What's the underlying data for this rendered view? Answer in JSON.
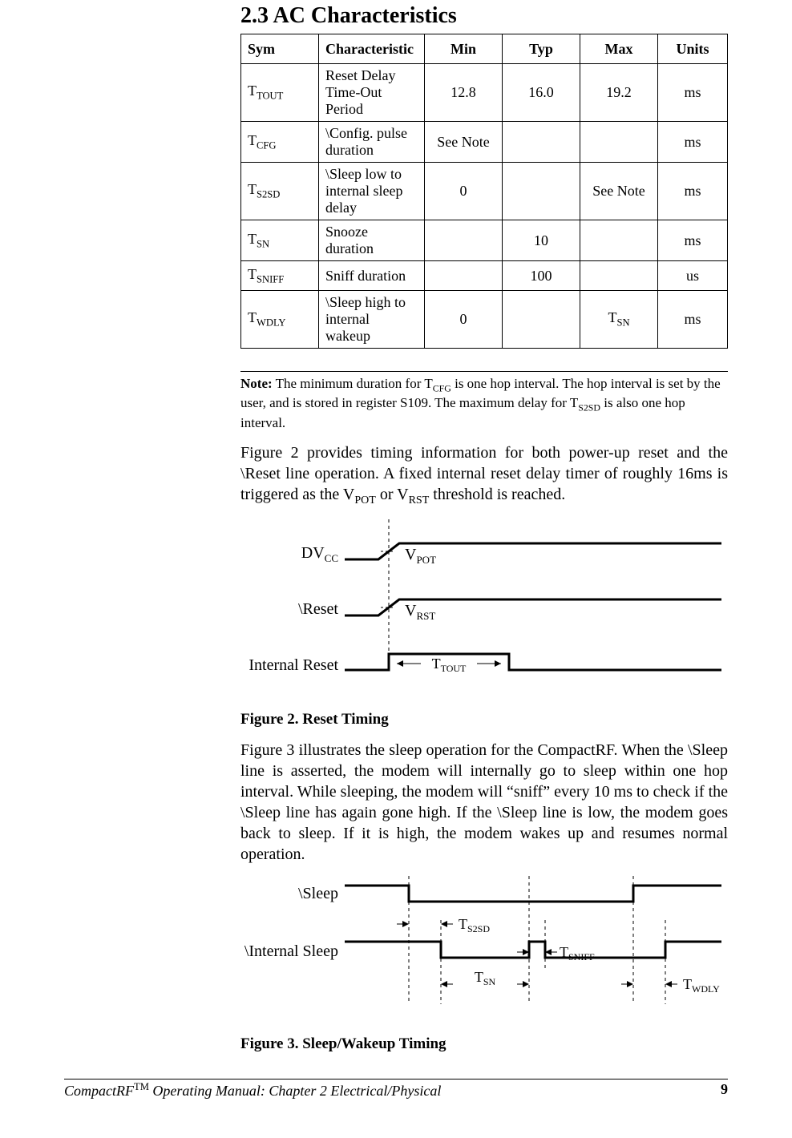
{
  "heading": "2.3  AC Characteristics",
  "table": {
    "headers": {
      "sym": "Sym",
      "char": "Characteristic",
      "min": "Min",
      "typ": "Typ",
      "max": "Max",
      "units": "Units"
    },
    "rows": [
      {
        "sym_base": "T",
        "sym_sub": "TOUT",
        "char": "Reset Delay Time-Out Period",
        "min": "12.8",
        "typ": "16.0",
        "max": "19.2",
        "units": "ms"
      },
      {
        "sym_base": "T",
        "sym_sub": "CFG",
        "char": "\\Config. pulse duration",
        "min": "See Note",
        "typ": "",
        "max": "",
        "units": "ms"
      },
      {
        "sym_base": "T",
        "sym_sub": "S2SD",
        "char": "\\Sleep low to internal sleep delay",
        "min": "0",
        "typ": "",
        "max": "See Note",
        "units": "ms"
      },
      {
        "sym_base": "T",
        "sym_sub": "SN",
        "char": "Snooze duration",
        "min": "",
        "typ": "10",
        "max": "",
        "units": "ms"
      },
      {
        "sym_base": "T",
        "sym_sub": "SNIFF",
        "char": "Sniff duration",
        "min": "",
        "typ": "100",
        "max": "",
        "units": "us"
      },
      {
        "sym_base": "T",
        "sym_sub": "WDLY",
        "char": "\\Sleep high to internal wakeup",
        "min": "0",
        "typ": "",
        "max_base": "T",
        "max_sub": "SN",
        "units": "ms"
      }
    ]
  },
  "note": {
    "lead": "Note:",
    "pre1": "  The minimum duration for T",
    "sub1": "CFG",
    "post1": " is one hop interval.  The hop interval is set by the user, and is stored in register S109.  The maximum delay for T",
    "sub2": "S2SD",
    "post2": " is also one hop interval."
  },
  "para1": {
    "pre": "Figure 2 provides timing information for both power-up reset and the \\Reset line operation.  A fixed internal reset delay timer of roughly 16ms is triggered as the V",
    "sub1": "POT",
    "mid": " or V",
    "sub2": "RST",
    "post": " threshold is reached."
  },
  "fig2": {
    "labels": {
      "dvcc": "DV",
      "dvcc_sub": "CC",
      "vpot": "V",
      "vpot_sub": "POT",
      "reset": "\\Reset",
      "vrst": "V",
      "vrst_sub": "RST",
      "internal": "Internal Reset",
      "ttout": "T",
      "ttout_sub": "TOUT"
    },
    "caption": "Figure 2.  Reset Timing"
  },
  "para2": "Figure 3 illustrates the sleep operation for the CompactRF.  When the \\Sleep line is asserted, the modem will internally go to sleep within one hop interval.  While sleeping, the modem will “sniff” every 10 ms to check if the \\Sleep line has again gone high.  If the \\Sleep line is low, the modem goes back to sleep.  If it is high, the modem wakes up and resumes normal operation.",
  "fig3": {
    "labels": {
      "sleep": "\\Sleep",
      "internal": "\\Internal Sleep",
      "ts2sd": "T",
      "ts2sd_sub": "S2SD",
      "tsniff": "T",
      "tsniff_sub": "SNIFF",
      "tsn": "T",
      "tsn_sub": "SN",
      "twdly": "T",
      "twdly_sub": "WDLY"
    },
    "caption": "Figure 3.  Sleep/Wakeup Timing"
  },
  "footer": {
    "left_pre": "CompactRF",
    "left_sup": "TM",
    "left_post": " Operating Manual: Chapter 2 Electrical/Physical",
    "page": "9"
  }
}
